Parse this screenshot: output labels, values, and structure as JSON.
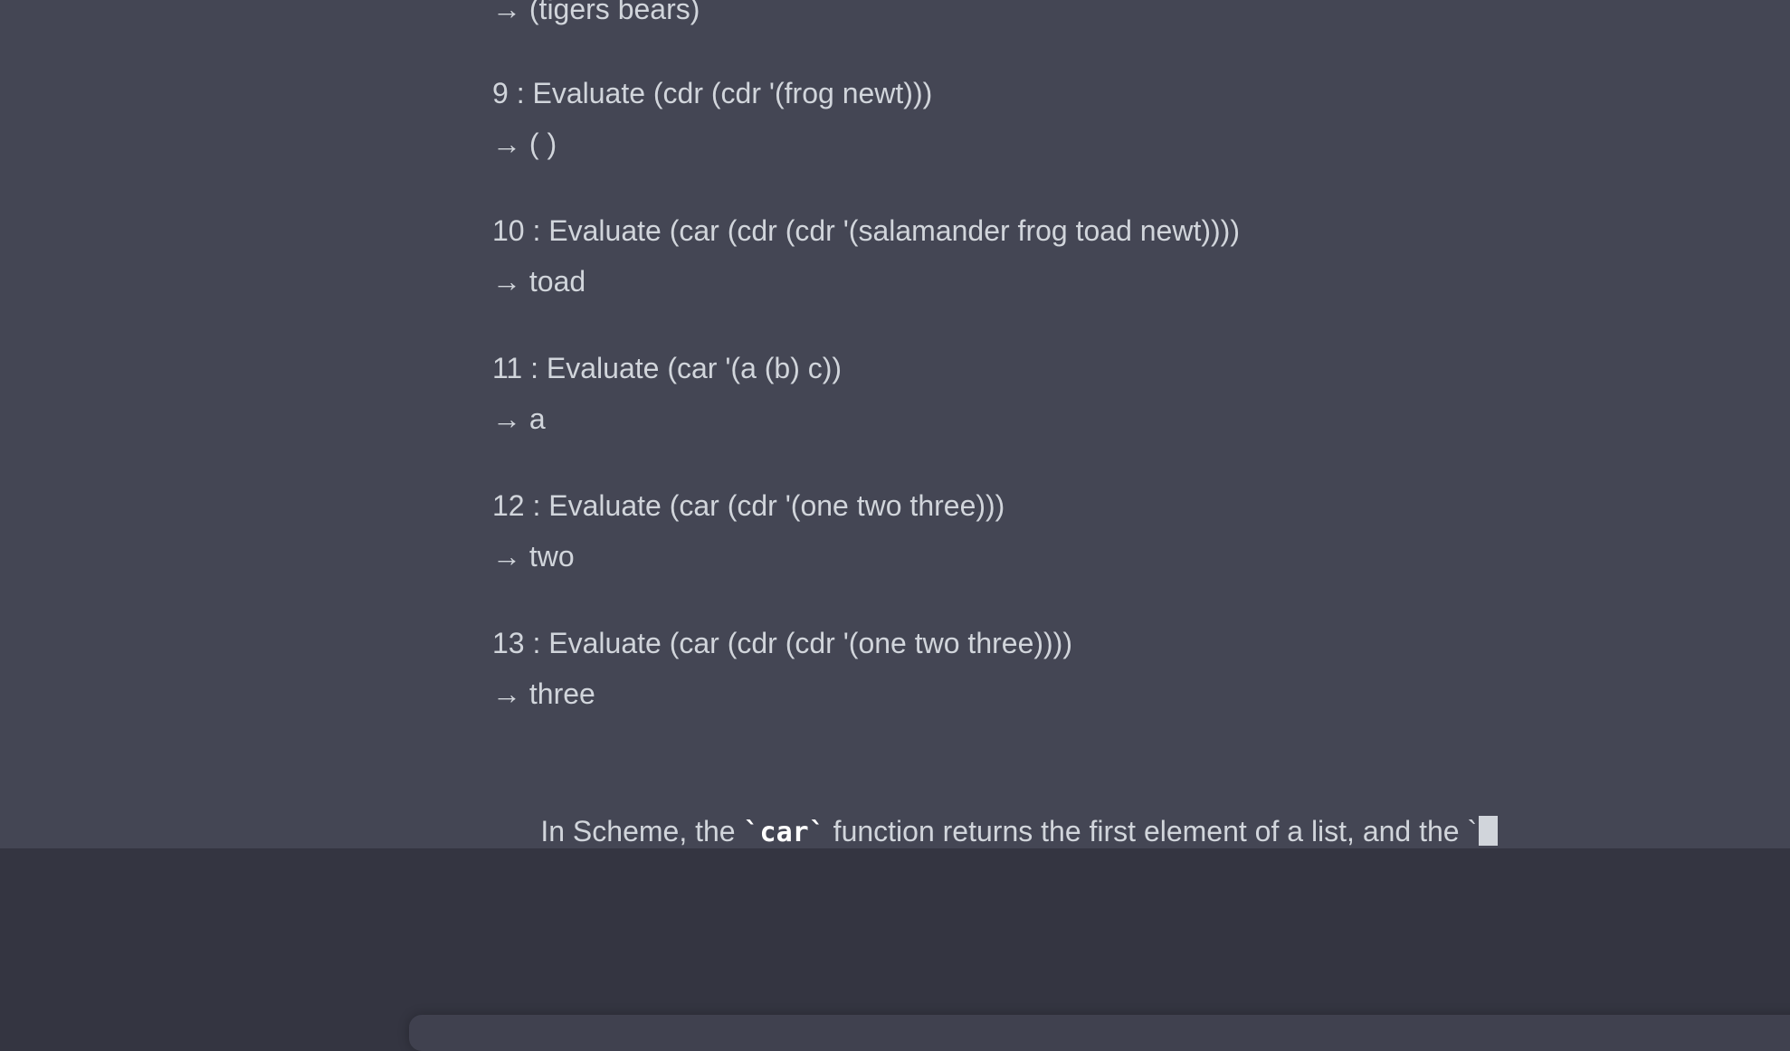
{
  "conversation": {
    "partial_answer_top": "→ (tigers bears)",
    "items": [
      {
        "question": "9 : Evaluate (cdr (cdr '(frog newt)))",
        "answer": "→ ( )"
      },
      {
        "question": "10 : Evaluate (car (cdr (cdr '(salamander frog toad newt))))",
        "answer": "→ toad"
      },
      {
        "question": "11 : Evaluate (car '(a (b) c))",
        "answer": "→ a"
      },
      {
        "question": "12 : Evaluate (car (cdr '(one two three)))",
        "answer": "→ two"
      },
      {
        "question": "13 : Evaluate (car (cdr (cdr '(one two three))))",
        "answer": "→ three"
      }
    ],
    "closing": {
      "prefix": "In Scheme, the ",
      "code": "`car`",
      "suffix": " function returns the first element of a list, and the `"
    }
  }
}
